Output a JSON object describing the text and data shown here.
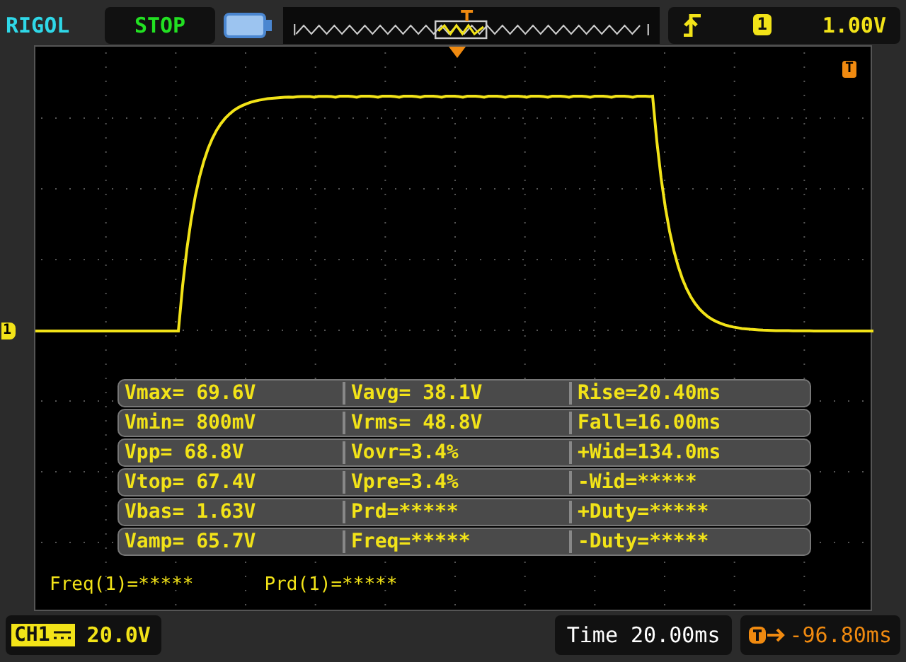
{
  "top_bar": {
    "brand": "RIGOL",
    "run_state": "STOP",
    "trigger": {
      "channel": "1",
      "level": "1.00V"
    }
  },
  "screen": {
    "channel_marker": "1",
    "trigger_marker": "T",
    "measurements": [
      [
        "Vmax= 69.6V",
        "Vavg= 38.1V",
        "Rise=20.40ms"
      ],
      [
        "Vmin= 800mV",
        "Vrms= 48.8V",
        "Fall=16.00ms"
      ],
      [
        "Vpp= 68.8V",
        "Vovr=3.4%",
        "+Wid=134.0ms"
      ],
      [
        "Vtop= 67.4V",
        "Vpre=3.4%",
        "-Wid=*****"
      ],
      [
        "Vbas= 1.63V",
        "Prd=*****",
        "+Duty=*****"
      ],
      [
        "Vamp= 65.7V",
        "Freq=*****",
        "-Duty=*****"
      ]
    ],
    "readouts": [
      "Freq(1)=*****",
      "Prd(1)=*****"
    ]
  },
  "status_bar": {
    "channel": "CH1",
    "scale": "20.0V",
    "timebase": "Time 20.00ms",
    "trigger_offset": "-96.80ms"
  }
}
